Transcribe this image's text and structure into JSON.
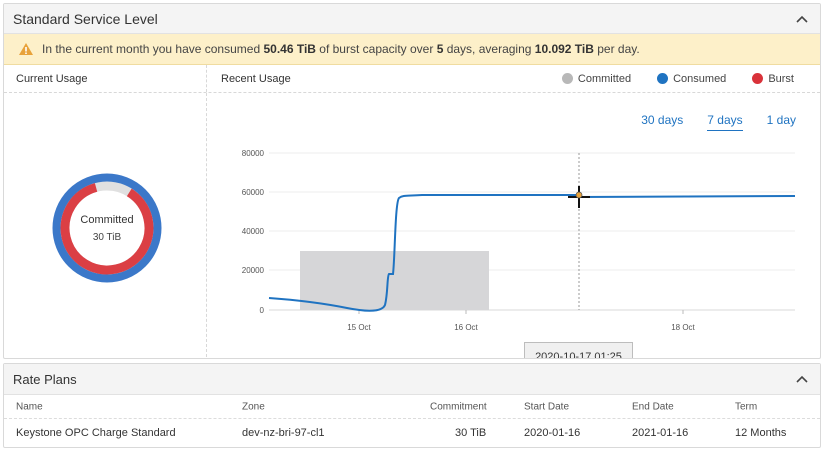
{
  "panel": {
    "title": "Standard Service Level",
    "alert": {
      "prefix": "In the current month you have consumed ",
      "consumed": "50.46 TiB",
      "middle": " of burst capacity over ",
      "days": "5",
      "days_suffix": " days, averaging ",
      "average": "10.092 TiB",
      "suffix": " per day.",
      "icon": "warning-triangle-icon",
      "color": "#e8a23a"
    }
  },
  "current_usage": {
    "heading": "Current Usage",
    "donut": {
      "label": "Committed",
      "value": "30 TiB"
    }
  },
  "recent_usage": {
    "heading": "Recent Usage",
    "legend": [
      {
        "label": "Committed",
        "color": "#b8b8b8"
      },
      {
        "label": "Consumed",
        "color": "#1f73c1"
      },
      {
        "label": "Burst",
        "color": "#d9323a"
      }
    ],
    "ranges": [
      {
        "label": "30 days",
        "active": false
      },
      {
        "label": "7 days",
        "active": true
      },
      {
        "label": "1 day",
        "active": false
      }
    ],
    "tooltip": "2020-10-17 01:25"
  },
  "chart_data": {
    "type": "line",
    "yticks": [
      "80000",
      "60000",
      "40000",
      "20000",
      "0"
    ],
    "xticks": [
      "15 Oct",
      "16 Oct",
      "18 Oct"
    ],
    "ylim": [
      0,
      80000
    ],
    "series": [
      {
        "name": "Consumed",
        "color": "#1f73c1"
      }
    ]
  },
  "rate_plans": {
    "title": "Rate Plans",
    "columns": [
      "Name",
      "Zone",
      "Commitment",
      "Start Date",
      "End Date",
      "Term"
    ],
    "rows": [
      [
        "Keystone OPC Charge Standard",
        "dev-nz-bri-97-cl1",
        "30 TiB",
        "2020-01-16",
        "2021-01-16",
        "12 Months"
      ]
    ]
  }
}
